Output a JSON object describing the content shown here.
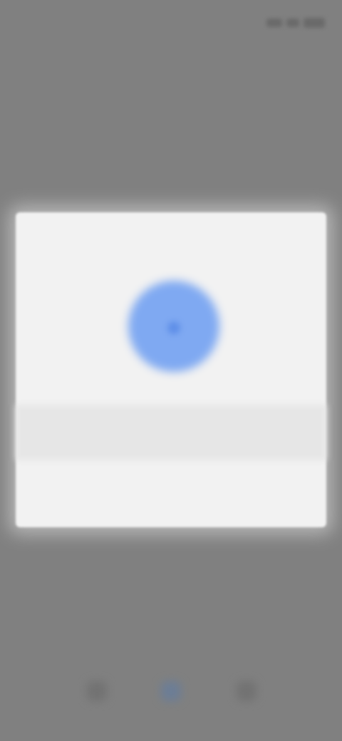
{
  "status_bar": {
    "time": "",
    "icons": [
      "signal-icon",
      "wifi-icon",
      "battery-icon"
    ]
  },
  "header": {
    "title": ""
  },
  "modal": {
    "title": "",
    "icon": "blue-circle-icon",
    "message": "",
    "button_label": ""
  },
  "bottom_nav": {
    "items": [
      {
        "icon": "nav-home-icon",
        "active": false
      },
      {
        "icon": "nav-center-icon",
        "active": true
      },
      {
        "icon": "nav-profile-icon",
        "active": false
      }
    ]
  },
  "colors": {
    "overlay": "#808080",
    "modal_bg": "#f2f2f2",
    "accent": "#7fa9f2"
  }
}
